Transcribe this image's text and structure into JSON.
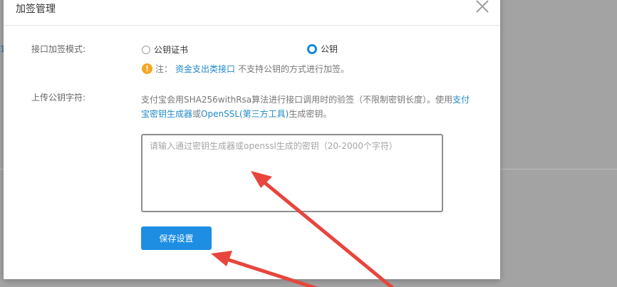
{
  "backdrop": {
    "fragment": "1"
  },
  "modal": {
    "title": "加签管理",
    "sign_mode": {
      "label": "接口加签模式:",
      "options": [
        {
          "label": "公钥证书",
          "selected": false
        },
        {
          "label": "公钥",
          "selected": true
        }
      ]
    },
    "note": {
      "prefix": "注：",
      "link": "资金支出类接口",
      "suffix": "不支持公钥的方式进行加签。"
    },
    "public_key": {
      "label": "上传公钥字符:",
      "desc_part1": "支付宝会用SHA256withRsa算法进行接口调用时的验签（不限制密钥长度）。使用",
      "desc_link1": "支付宝密钥生成器",
      "desc_or": "或",
      "desc_link2": "OpenSSL(第三方工具)",
      "desc_part2": "生成密钥。",
      "placeholder": "请输入通过密钥生成器或openssl生成的密钥（20-2000个字符）",
      "value": ""
    },
    "save_label": "保存设置"
  },
  "colors": {
    "accent": "#1e8ee3",
    "link": "#1f8ac9",
    "warning": "#f5a623",
    "annotation_arrow": "#e8453c"
  }
}
